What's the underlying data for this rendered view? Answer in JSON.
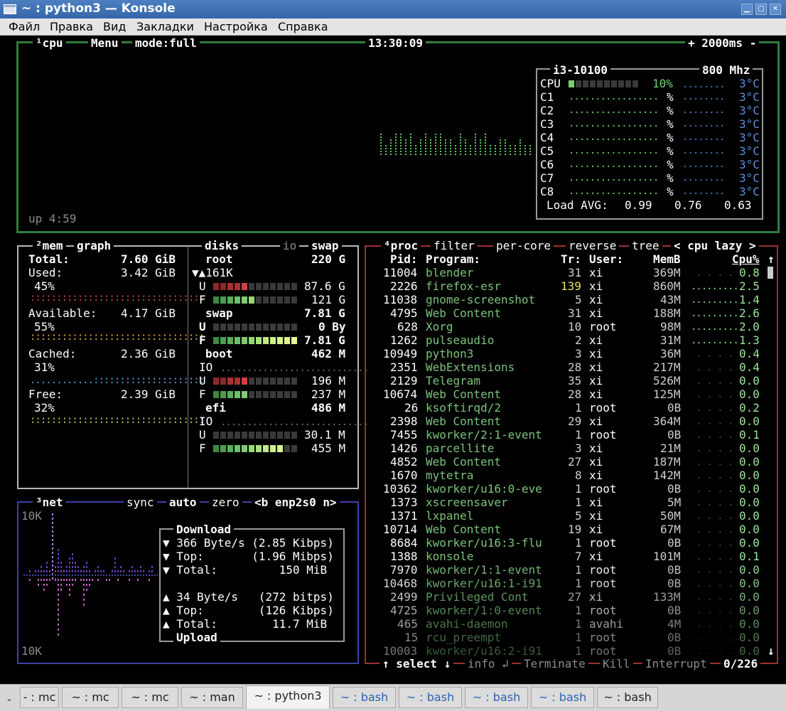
{
  "window": {
    "title": "~ : python3 — Konsole"
  },
  "menu": [
    "Файл",
    "Правка",
    "Вид",
    "Закладки",
    "Настройка",
    "Справка"
  ],
  "cpu_box": {
    "number": "¹",
    "label": "cpu",
    "menu": "Menu",
    "mode": "mode:full",
    "clock": "13:30:09",
    "interval": "+ 2000ms -",
    "uptime": "up 4:59",
    "model": "i3-10100",
    "freq": "800 Mhz",
    "total_label": "CPU",
    "total_pct": "10%",
    "temp": "3°C",
    "cores": [
      {
        "name": "C1",
        "pct": "%",
        "temp": "3°C"
      },
      {
        "name": "C2",
        "pct": "%",
        "temp": "3°C"
      },
      {
        "name": "C3",
        "pct": "%",
        "temp": "3°C"
      },
      {
        "name": "C4",
        "pct": "%",
        "temp": "3°C"
      },
      {
        "name": "C5",
        "pct": "%",
        "temp": "3°C"
      },
      {
        "name": "C6",
        "pct": "%",
        "temp": "3°C"
      },
      {
        "name": "C7",
        "pct": "%",
        "temp": "3°C"
      },
      {
        "name": "C8",
        "pct": "%",
        "temp": "3°C"
      }
    ],
    "load_label": "Load AVG:",
    "load": [
      "0.99",
      "0.76",
      "0.63"
    ]
  },
  "mem_box": {
    "number": "²",
    "label": "mem",
    "graph": "graph",
    "total": {
      "label": "Total:",
      "value": "7.60 GiB"
    },
    "used": {
      "label": "Used:",
      "value": "3.42 GiB",
      "pct": "45%",
      "color": "#d14b4b"
    },
    "available": {
      "label": "Available:",
      "value": "4.17 GiB",
      "pct": "55%",
      "color": "#e0b030"
    },
    "cached": {
      "label": "Cached:",
      "value": "2.36 GiB",
      "pct": "31%",
      "color": "#5aa6d6"
    },
    "free": {
      "label": "Free:",
      "value": "2.39 GiB",
      "pct": "32%",
      "color": "#b8d650"
    }
  },
  "disks": {
    "label": "disks",
    "io": "io",
    "swap": "swap",
    "root": {
      "name": "root",
      "size": "220 G",
      "io": "▼▲161K",
      "u": "87.6 G",
      "f": "121 G"
    },
    "swap_d": {
      "name": "swap",
      "size": "7.81 G",
      "u": "0 By",
      "f": "7.81 G"
    },
    "boot": {
      "name": "boot",
      "size": "462 M",
      "io": "IO",
      "u": "196 M",
      "f": "237 M"
    },
    "efi": {
      "name": "efi",
      "size": "486 M",
      "io": "IO",
      "u": "30.1 M",
      "f": "455 M"
    },
    "u_label": "U",
    "f_label": "F"
  },
  "net_box": {
    "number": "³",
    "label": "net",
    "sync": "sync",
    "auto": "auto",
    "zero": "zero",
    "iface": "<b enp2s0 n>",
    "scale_top": "10K",
    "scale_bottom": "10K",
    "download": {
      "title": "Download",
      "rate": "▼ 366 Byte/s (2.85 Kibps)",
      "top": "▼ Top:       (1.96 Mibps)",
      "total": "▼ Total:         150 MiB"
    },
    "upload": {
      "title": "Upload",
      "rate": "▲ 34 Byte/s   (272 bitps)",
      "top": "▲ Top:        (126 Kibps)",
      "total": "▲ Total:        11.7 MiB"
    }
  },
  "proc_box": {
    "number": "⁴",
    "label": "proc",
    "filter": "filter",
    "per_core": "per-core",
    "reverse": "reverse",
    "tree": "tree",
    "sort": "< cpu lazy >",
    "headers": {
      "pid": "Pid:",
      "program": "Program:",
      "tr": "Tr:",
      "user": "User:",
      "mem": "MemB",
      "cpu": "Cpu%"
    },
    "rows": [
      {
        "pid": "11004",
        "program": "blender",
        "tr": "31",
        "user": "xi",
        "mem": "369M",
        "cpu": "0.8"
      },
      {
        "pid": "2226",
        "program": "firefox-esr",
        "tr": "139",
        "user": "xi",
        "mem": "860M",
        "cpu": "2.5"
      },
      {
        "pid": "11038",
        "program": "gnome-screenshot",
        "tr": "5",
        "user": "xi",
        "mem": "43M",
        "cpu": "1.4"
      },
      {
        "pid": "4795",
        "program": "Web Content",
        "tr": "31",
        "user": "xi",
        "mem": "188M",
        "cpu": "2.6"
      },
      {
        "pid": "628",
        "program": "Xorg",
        "tr": "10",
        "user": "root",
        "mem": "98M",
        "cpu": "2.0"
      },
      {
        "pid": "1262",
        "program": "pulseaudio",
        "tr": "2",
        "user": "xi",
        "mem": "31M",
        "cpu": "1.3"
      },
      {
        "pid": "10949",
        "program": "python3",
        "tr": "3",
        "user": "xi",
        "mem": "36M",
        "cpu": "0.4"
      },
      {
        "pid": "2351",
        "program": "WebExtensions",
        "tr": "28",
        "user": "xi",
        "mem": "217M",
        "cpu": "0.4"
      },
      {
        "pid": "2129",
        "program": "Telegram",
        "tr": "35",
        "user": "xi",
        "mem": "526M",
        "cpu": "0.0"
      },
      {
        "pid": "10674",
        "program": "Web Content",
        "tr": "28",
        "user": "xi",
        "mem": "125M",
        "cpu": "0.0"
      },
      {
        "pid": "26",
        "program": "ksoftirqd/2",
        "tr": "1",
        "user": "root",
        "mem": "0B",
        "cpu": "0.2"
      },
      {
        "pid": "2398",
        "program": "Web Content",
        "tr": "29",
        "user": "xi",
        "mem": "364M",
        "cpu": "0.0"
      },
      {
        "pid": "7455",
        "program": "kworker/2:1-event",
        "tr": "1",
        "user": "root",
        "mem": "0B",
        "cpu": "0.1"
      },
      {
        "pid": "1426",
        "program": "parcellite",
        "tr": "3",
        "user": "xi",
        "mem": "21M",
        "cpu": "0.0"
      },
      {
        "pid": "4852",
        "program": "Web Content",
        "tr": "27",
        "user": "xi",
        "mem": "187M",
        "cpu": "0.0"
      },
      {
        "pid": "1670",
        "program": "mytetra",
        "tr": "8",
        "user": "xi",
        "mem": "142M",
        "cpu": "0.0"
      },
      {
        "pid": "10362",
        "program": "kworker/u16:0-eve",
        "tr": "1",
        "user": "root",
        "mem": "0B",
        "cpu": "0.0"
      },
      {
        "pid": "1373",
        "program": "xscreensaver",
        "tr": "1",
        "user": "xi",
        "mem": "5M",
        "cpu": "0.0"
      },
      {
        "pid": "1371",
        "program": "lxpanel",
        "tr": "5",
        "user": "xi",
        "mem": "50M",
        "cpu": "0.0"
      },
      {
        "pid": "10714",
        "program": "Web Content",
        "tr": "19",
        "user": "xi",
        "mem": "67M",
        "cpu": "0.0"
      },
      {
        "pid": "8684",
        "program": "kworker/u16:3-flu",
        "tr": "1",
        "user": "root",
        "mem": "0B",
        "cpu": "0.0"
      },
      {
        "pid": "1388",
        "program": "konsole",
        "tr": "7",
        "user": "xi",
        "mem": "101M",
        "cpu": "0.1"
      },
      {
        "pid": "7970",
        "program": "kworker/1:1-event",
        "tr": "1",
        "user": "root",
        "mem": "0B",
        "cpu": "0.0"
      },
      {
        "pid": "10468",
        "program": "kworker/u16:1-i91",
        "tr": "1",
        "user": "root",
        "mem": "0B",
        "cpu": "0.0"
      },
      {
        "pid": "2499",
        "program": "Privileged Cont",
        "tr": "27",
        "user": "xi",
        "mem": "133M",
        "cpu": "0.0"
      },
      {
        "pid": "4725",
        "program": "kworker/1:0-event",
        "tr": "1",
        "user": "root",
        "mem": "0B",
        "cpu": "0.0"
      },
      {
        "pid": "465",
        "program": "avahi-daemon",
        "tr": "1",
        "user": "avahi",
        "mem": "4M",
        "cpu": "0.0"
      },
      {
        "pid": "15",
        "program": "rcu_preempt",
        "tr": "1",
        "user": "root",
        "mem": "0B",
        "cpu": "0.0"
      },
      {
        "pid": "10003",
        "program": "kworker/u16:2-i91",
        "tr": "1",
        "user": "root",
        "mem": "0B",
        "cpu": "0.0"
      }
    ],
    "footer": {
      "select": "↑ select ↓",
      "info": "info ↲",
      "terminate": "Terminate",
      "kill": "Kill",
      "interrupt": "Interrupt",
      "count": "0/226"
    }
  },
  "tabs": [
    {
      "label": "- : mc",
      "color": "normal"
    },
    {
      "label": "~ : mc",
      "color": "normal"
    },
    {
      "label": "~ : mc",
      "color": "normal"
    },
    {
      "label": "~ : man",
      "color": "normal"
    },
    {
      "label": "~ : python3",
      "color": "active"
    },
    {
      "label": "~ : bash",
      "color": "blue"
    },
    {
      "label": "~ : bash",
      "color": "blue"
    },
    {
      "label": "~ : bash",
      "color": "blue"
    },
    {
      "label": "~ : bash",
      "color": "blue"
    },
    {
      "label": "~ : bash",
      "color": "normal"
    }
  ]
}
